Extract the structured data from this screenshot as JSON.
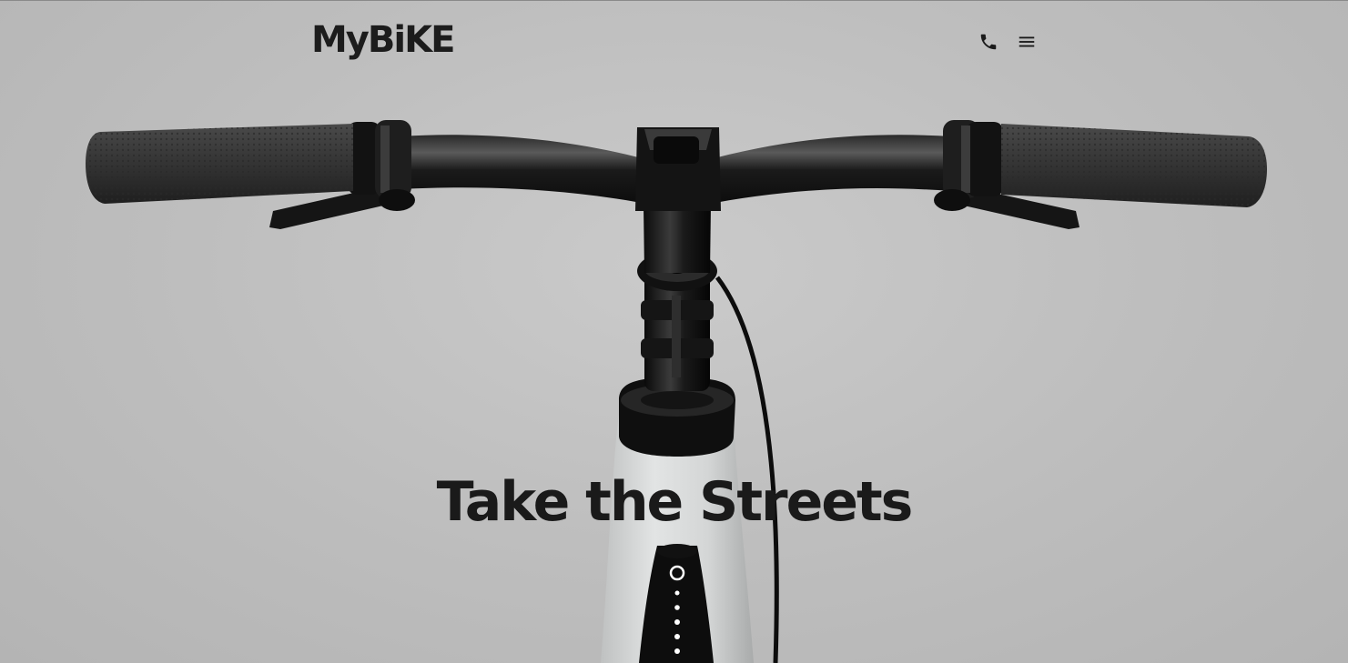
{
  "header": {
    "logo_text": "MyBiKE",
    "phone_icon": "phone-icon",
    "menu_icon": "hamburger-menu-icon"
  },
  "hero": {
    "headline": "Take the Streets"
  },
  "colors": {
    "background": "#c3c3c3",
    "text": "#1a1a1a",
    "bike_black": "#111111",
    "frame_white": "#d4d6d6"
  }
}
